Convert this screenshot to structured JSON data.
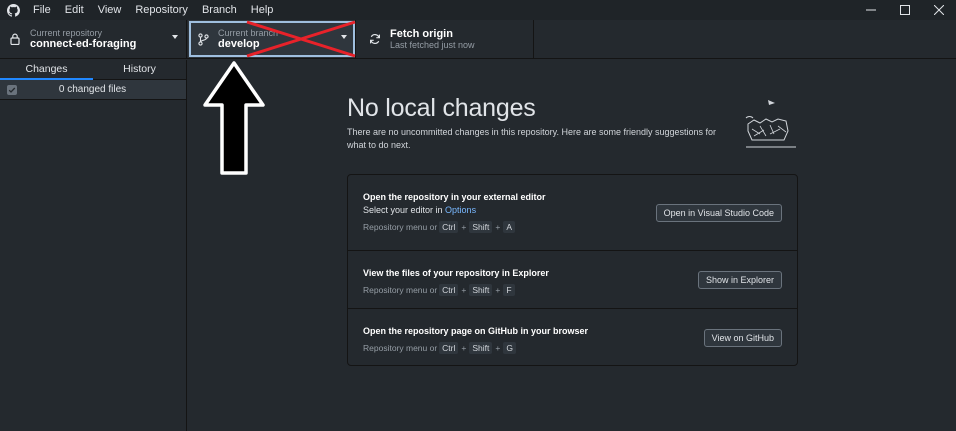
{
  "menubar": {
    "items": [
      "File",
      "Edit",
      "View",
      "Repository",
      "Branch",
      "Help"
    ]
  },
  "toolbar": {
    "repo_sub": "Current repository",
    "repo_name": "connect-ed-foraging",
    "branch_sub": "Current branch",
    "branch_name": "develop",
    "fetch_title": "Fetch origin",
    "fetch_sub": "Last fetched just now"
  },
  "sidebar": {
    "tabs": [
      "Changes",
      "History"
    ],
    "changed_files": "0 changed files"
  },
  "main": {
    "title": "No local changes",
    "description": "There are no uncommitted changes in this repository. Here are some friendly suggestions for what to do next.",
    "actions": [
      {
        "title": "Open the repository in your external editor",
        "desc_prefix": "Select your editor in ",
        "desc_link": "Options",
        "shortcut_prefix": "Repository menu or",
        "keys": [
          "Ctrl",
          "Shift",
          "A"
        ],
        "button": "Open in Visual Studio Code"
      },
      {
        "title": "View the files of your repository in Explorer",
        "shortcut_prefix": "Repository menu or",
        "keys": [
          "Ctrl",
          "Shift",
          "F"
        ],
        "button": "Show in Explorer"
      },
      {
        "title": "Open the repository page on GitHub in your browser",
        "shortcut_prefix": "Repository menu or",
        "keys": [
          "Ctrl",
          "Shift",
          "G"
        ],
        "button": "View on GitHub"
      }
    ],
    "key_separator": "+"
  },
  "colors": {
    "accent": "#2188ff",
    "link": "#79b8ff",
    "annotation_x": "#e8222a",
    "annotation_arrow": "#000000"
  },
  "icons": [
    "github-logo-icon",
    "lock-icon",
    "branch-icon",
    "sync-icon",
    "caret-down-icon",
    "checkbox-icon",
    "minimize-icon",
    "maximize-icon",
    "close-icon"
  ]
}
